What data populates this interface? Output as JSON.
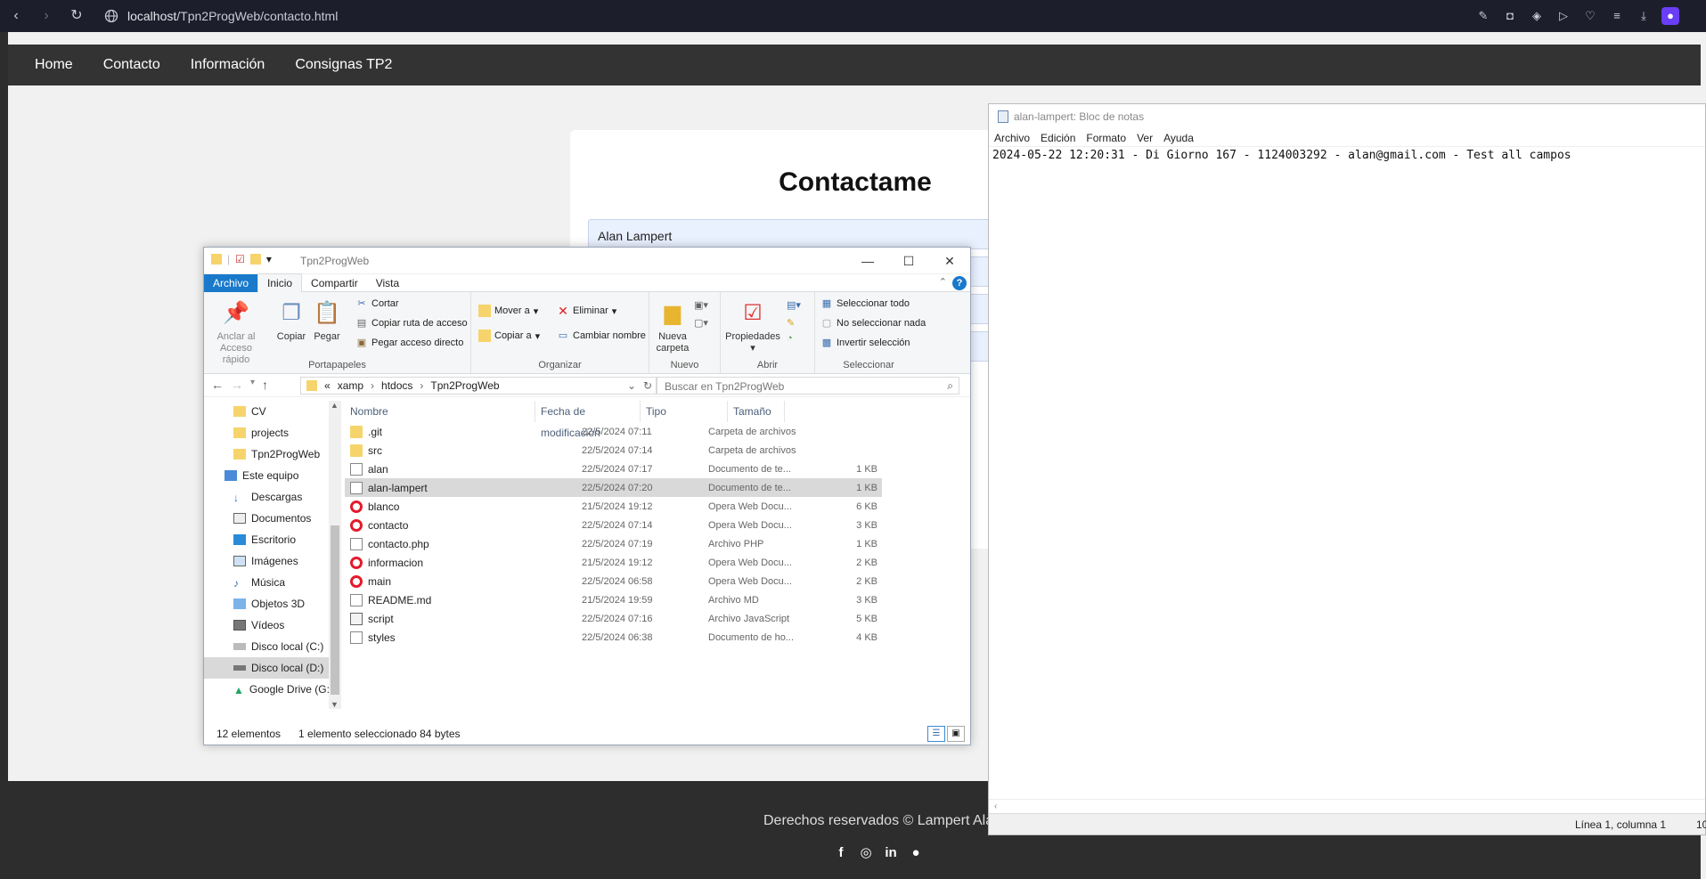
{
  "browser": {
    "url_host": "localhost",
    "url_path": "/Tpn2ProgWeb/contacto.html"
  },
  "site": {
    "nav": [
      "Home",
      "Contacto",
      "Información",
      "Consignas TP2"
    ],
    "heading": "Contactame",
    "name_field_value": "Alan Lampert",
    "footer_text": "Derechos reservados © Lampert Ala"
  },
  "explorer": {
    "title": "Tpn2ProgWeb",
    "tabs": {
      "file": "Archivo",
      "home": "Inicio",
      "share": "Compartir",
      "view": "Vista"
    },
    "ribbon": {
      "pin_label": "Anclar al Acceso rápido",
      "copy": "Copiar",
      "paste": "Pegar",
      "cut": "Cortar",
      "copy_path": "Copiar ruta de acceso",
      "paste_shortcut": "Pegar acceso directo",
      "group_clipboard": "Portapapeles",
      "move_to": "Mover a",
      "copy_to": "Copiar a",
      "delete": "Eliminar",
      "rename": "Cambiar nombre",
      "group_organize": "Organizar",
      "new_folder": "Nueva carpeta",
      "group_new": "Nuevo",
      "properties": "Propiedades",
      "group_open": "Abrir",
      "select_all": "Seleccionar todo",
      "select_none": "No seleccionar nada",
      "invert_selection": "Invertir selección",
      "group_select": "Seleccionar"
    },
    "address": {
      "prefix": "«",
      "crumbs": [
        "xamp",
        "htdocs",
        "Tpn2ProgWeb"
      ],
      "search_placeholder": "Buscar en Tpn2ProgWeb"
    },
    "nav_pane": [
      {
        "label": "CV",
        "icon": "folder"
      },
      {
        "label": "projects",
        "icon": "folder"
      },
      {
        "label": "Tpn2ProgWeb",
        "icon": "folder"
      },
      {
        "label": "Este equipo",
        "icon": "computer"
      },
      {
        "label": "Descargas",
        "icon": "download"
      },
      {
        "label": "Documentos",
        "icon": "documents"
      },
      {
        "label": "Escritorio",
        "icon": "desktop"
      },
      {
        "label": "Imágenes",
        "icon": "pictures"
      },
      {
        "label": "Música",
        "icon": "music"
      },
      {
        "label": "Objetos 3D",
        "icon": "3d-objects"
      },
      {
        "label": "Vídeos",
        "icon": "videos"
      },
      {
        "label": "Disco local (C:)",
        "icon": "drive"
      },
      {
        "label": "Disco local (D:)",
        "icon": "drive"
      },
      {
        "label": "Google Drive (G:",
        "icon": "google-drive"
      }
    ],
    "columns": [
      "Nombre",
      "Fecha de modificación",
      "Tipo",
      "Tamaño"
    ],
    "files": [
      {
        "name": ".git",
        "date": "22/5/2024 07:11",
        "type": "Carpeta de archivos",
        "size": "",
        "icon": "folder"
      },
      {
        "name": "src",
        "date": "22/5/2024 07:14",
        "type": "Carpeta de archivos",
        "size": "",
        "icon": "folder"
      },
      {
        "name": "alan",
        "date": "22/5/2024 07:17",
        "type": "Documento de te...",
        "size": "1 KB",
        "icon": "doc"
      },
      {
        "name": "alan-lampert",
        "date": "22/5/2024 07:20",
        "type": "Documento de te...",
        "size": "1 KB",
        "icon": "doc"
      },
      {
        "name": "blanco",
        "date": "21/5/2024 19:12",
        "type": "Opera Web Docu...",
        "size": "6 KB",
        "icon": "opera"
      },
      {
        "name": "contacto",
        "date": "22/5/2024 07:14",
        "type": "Opera Web Docu...",
        "size": "3 KB",
        "icon": "opera"
      },
      {
        "name": "contacto.php",
        "date": "22/5/2024 07:19",
        "type": "Archivo PHP",
        "size": "1 KB",
        "icon": "doc"
      },
      {
        "name": "informacion",
        "date": "21/5/2024 19:12",
        "type": "Opera Web Docu...",
        "size": "2 KB",
        "icon": "opera"
      },
      {
        "name": "main",
        "date": "22/5/2024 06:58",
        "type": "Opera Web Docu...",
        "size": "2 KB",
        "icon": "opera"
      },
      {
        "name": "README.md",
        "date": "21/5/2024 19:59",
        "type": "Archivo MD",
        "size": "3 KB",
        "icon": "doc"
      },
      {
        "name": "script",
        "date": "22/5/2024 07:16",
        "type": "Archivo JavaScript",
        "size": "5 KB",
        "icon": "js"
      },
      {
        "name": "styles",
        "date": "22/5/2024 06:38",
        "type": "Documento de ho...",
        "size": "4 KB",
        "icon": "doc"
      }
    ],
    "status": {
      "count": "12 elementos",
      "selection": "1 elemento seleccionado  84 bytes"
    }
  },
  "notepad": {
    "title": "alan-lampert: Bloc de notas",
    "menu": [
      "Archivo",
      "Edición",
      "Formato",
      "Ver",
      "Ayuda"
    ],
    "content": "2024-05-22 12:20:31 - Di Giorno 167 - 1124003292 - alan@gmail.com - Test all campos",
    "position": "Línea 1, columna 1",
    "zoom": "10"
  }
}
